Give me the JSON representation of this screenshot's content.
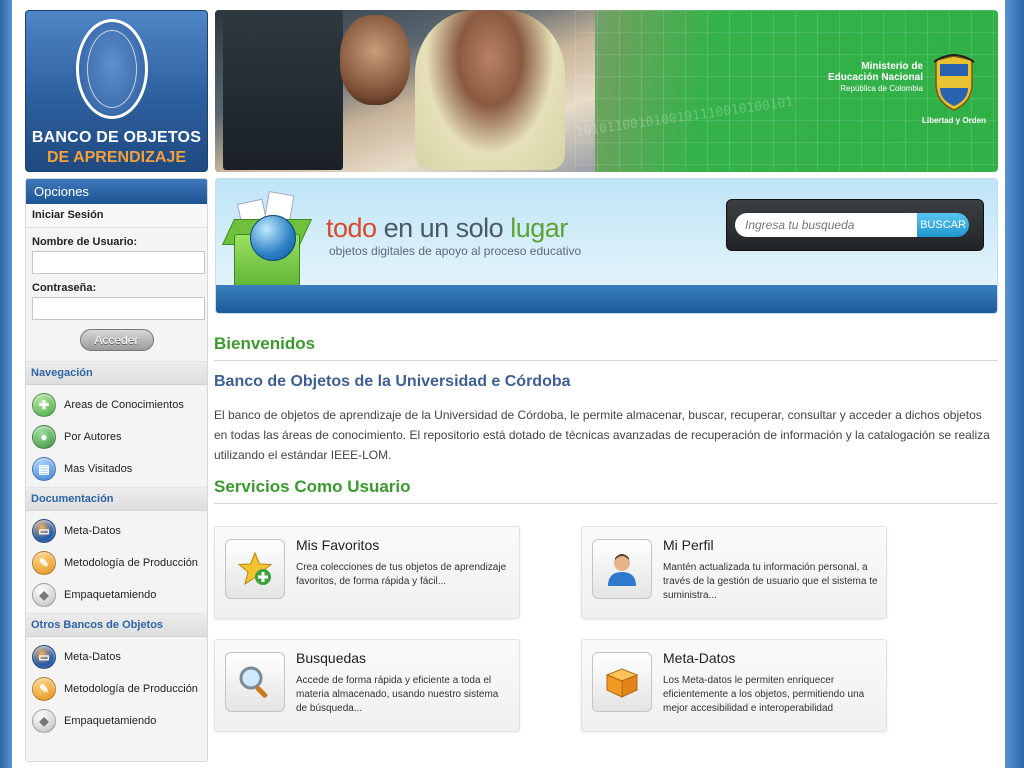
{
  "header": {
    "logo_line1": "BANCO DE OBJETOS",
    "logo_line2": "DE APRENDIZAJE",
    "ministry_line1": "Ministerio de",
    "ministry_line2": "Educación Nacional",
    "ministry_line3": "República de Colombia",
    "motto": "Libertad y Orden"
  },
  "search_strip": {
    "slogan_word1": "todo",
    "slogan_word2": "en un solo",
    "slogan_word3": "lugar",
    "subtitle": "objetos digitales de apoyo al proceso educativo",
    "search_placeholder": "Ingresa tu busqueda",
    "search_button": "BUSCAR"
  },
  "sidebar": {
    "title": "Opciones",
    "login": {
      "title": "Iniciar Sesión",
      "username_label": "Nombre de Usuario:",
      "password_label": "Contraseña:",
      "submit": "Acceder"
    },
    "sections": [
      {
        "title": "Navegación",
        "items": [
          {
            "label": "Areas de Conocimientos",
            "icon": "plus-puzzle-icon"
          },
          {
            "label": "Por Autores",
            "icon": "user-icon"
          },
          {
            "label": "Mas Visitados",
            "icon": "document-icon"
          }
        ]
      },
      {
        "title": "Documentación",
        "items": [
          {
            "label": "Meta-Datos",
            "icon": "metadata-icon"
          },
          {
            "label": "Metodología de Producción",
            "icon": "methodology-icon"
          },
          {
            "label": "Empaquetamiendo",
            "icon": "package-icon"
          }
        ]
      },
      {
        "title": "Otros Bancos de Objetos",
        "items": [
          {
            "label": "Meta-Datos",
            "icon": "metadata-icon"
          },
          {
            "label": "Metodología de Producción",
            "icon": "methodology-icon"
          },
          {
            "label": "Empaquetamiendo",
            "icon": "package-icon"
          }
        ]
      }
    ]
  },
  "main": {
    "welcome": "Bienvenidos",
    "subtitle": "Banco de Objetos de la Universidad e Córdoba",
    "intro": "El banco de objetos de aprendizaje de la Universidad de Córdoba, le permite almacenar, buscar, recuperar, consultar y acceder a dichos objetos en todas las áreas de conocimiento. El repositorio está dotado de técnicas avanzadas de recuperación de información y la catalogación se realiza utilizando el estándar IEEE-LOM.",
    "services_title": "Servicios Como Usuario",
    "services": [
      {
        "title": "Mis Favoritos",
        "desc": "Crea colecciones de tus objetos de aprendizaje favoritos, de forma rápida y fácil...",
        "icon": "star-add-icon"
      },
      {
        "title": "Mi Perfil",
        "desc": "Mantén actualizada tu información personal, a través de la gestión de usuario que el sistema te suministra...",
        "icon": "profile-icon"
      },
      {
        "title": "Busquedas",
        "desc": "Accede de forma rápida y eficiente a toda el materia almacenado, usando nuestro sistema de búsqueda...",
        "icon": "magnifier-icon"
      },
      {
        "title": "Meta-Datos",
        "desc": "Los Meta-datos le permiten enriquecer eficientemente a los objetos, permitiendo una mejor accesibilidad e interoperabilidad",
        "icon": "box-icon"
      }
    ]
  },
  "colors": {
    "accent_green": "#3a9a2d",
    "accent_blue": "#2f64a4",
    "frame_blue": "#2f6fb0"
  }
}
